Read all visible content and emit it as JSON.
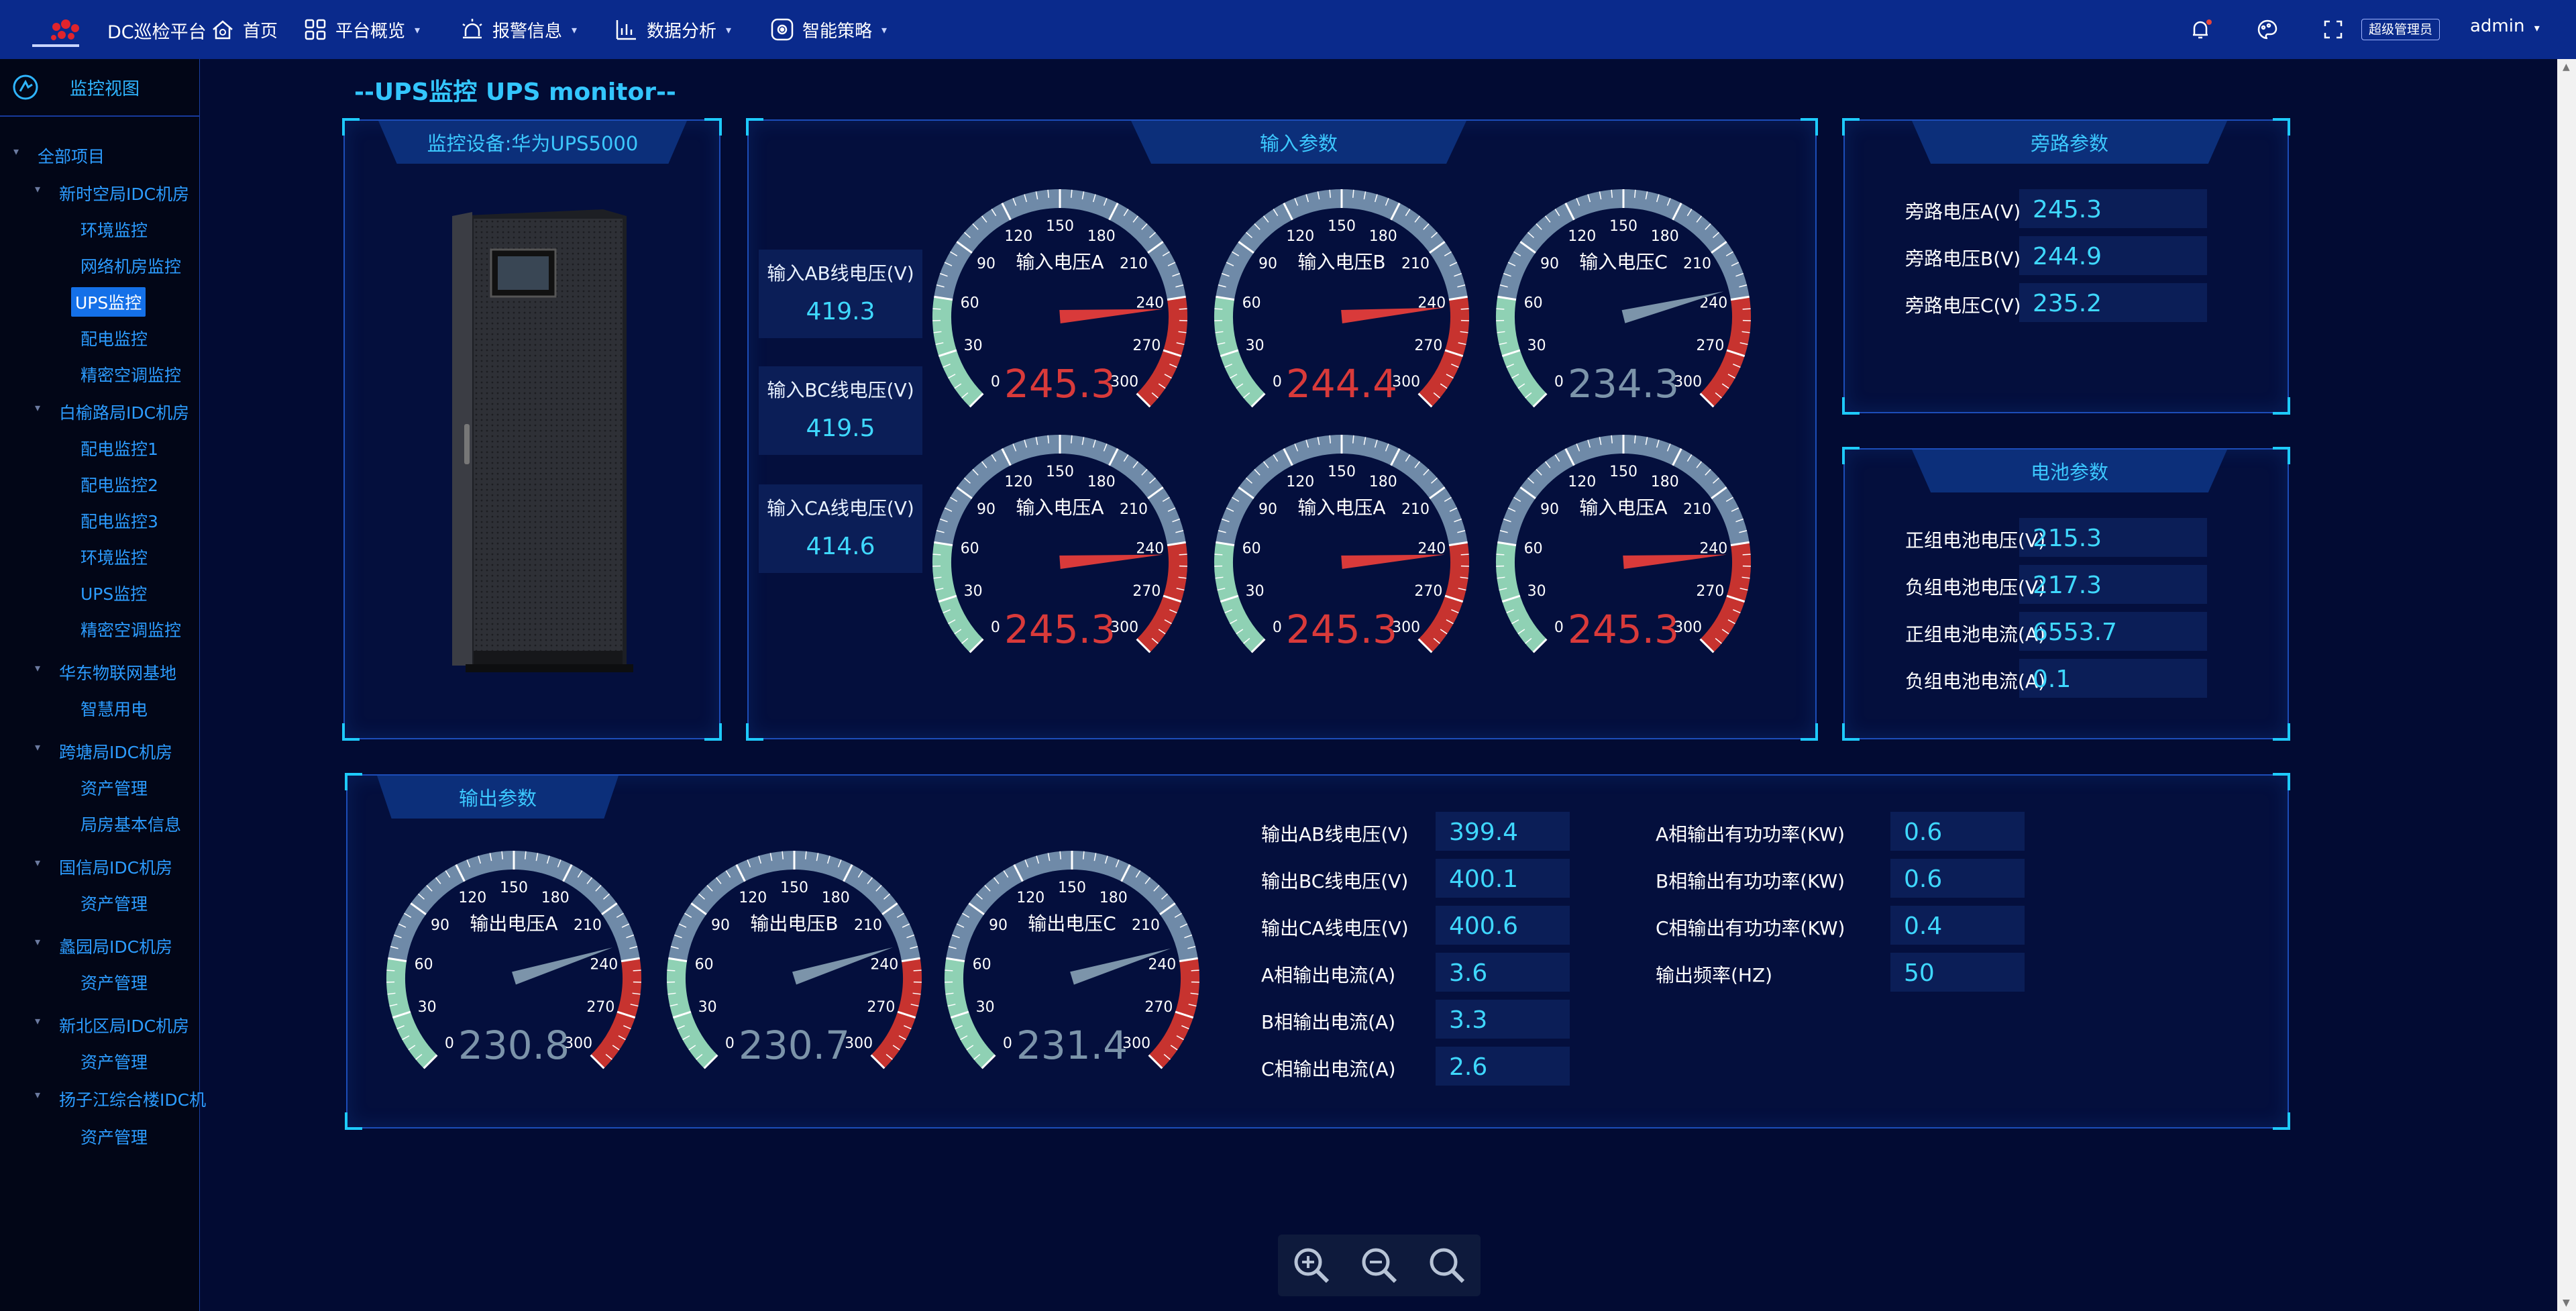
{
  "header": {
    "app_title": "DC巡检平台",
    "nav": [
      {
        "label": "首页",
        "icon": "home-icon",
        "caret": false
      },
      {
        "label": "平台概览",
        "icon": "grid-icon",
        "caret": true
      },
      {
        "label": "报警信息",
        "icon": "alarm-icon",
        "caret": true
      },
      {
        "label": "数据分析",
        "icon": "bar-chart-icon",
        "caret": true
      },
      {
        "label": "智能策略",
        "icon": "strategy-icon",
        "caret": true
      }
    ],
    "role": "超级管理员",
    "user": "admin",
    "caret": "▾"
  },
  "sidebar": {
    "heading": "监控视图",
    "items": [
      {
        "label": "全部项目",
        "level": 0,
        "arrow": true
      },
      {
        "label": "新时空局IDC机房",
        "level": 1,
        "arrow": true
      },
      {
        "label": "环境监控",
        "level": 2
      },
      {
        "label": "网络机房监控",
        "level": 2
      },
      {
        "label": "UPS监控",
        "level": 2,
        "active": true
      },
      {
        "label": "配电监控",
        "level": 2
      },
      {
        "label": "精密空调监控",
        "level": 2
      },
      {
        "label": "白榆路局IDC机房",
        "level": 1,
        "arrow": true
      },
      {
        "label": "配电监控1",
        "level": 2
      },
      {
        "label": "配电监控2",
        "level": 2
      },
      {
        "label": "配电监控3",
        "level": 2
      },
      {
        "label": "环境监控",
        "level": 2
      },
      {
        "label": "UPS监控",
        "level": 2
      },
      {
        "label": "精密空调监控",
        "level": 2
      },
      {
        "label": "华东物联网基地",
        "level": 1,
        "arrow": true
      },
      {
        "label": "智慧用电",
        "level": 2
      },
      {
        "label": "跨塘局IDC机房",
        "level": 1,
        "arrow": true
      },
      {
        "label": "资产管理",
        "level": 2
      },
      {
        "label": "局房基本信息",
        "level": 2
      },
      {
        "label": "国信局IDC机房",
        "level": 1,
        "arrow": true
      },
      {
        "label": "资产管理",
        "level": 2
      },
      {
        "label": "蠡园局IDC机房",
        "level": 1,
        "arrow": true
      },
      {
        "label": "资产管理",
        "level": 2
      },
      {
        "label": "新北区局IDC机房",
        "level": 1,
        "arrow": true
      },
      {
        "label": "资产管理",
        "level": 2
      },
      {
        "label": "扬子江综合楼IDC机",
        "level": 1,
        "arrow": true
      },
      {
        "label": "资产管理",
        "level": 2
      }
    ]
  },
  "page_title": "--UPS监控 UPS monitor--",
  "device_panel": {
    "title": "监控设备:华为UPS5000"
  },
  "input_panel": {
    "title": "输入参数",
    "line_voltages": [
      {
        "label": "输入AB线电压(V)",
        "value": "419.3"
      },
      {
        "label": "输入BC线电压(V)",
        "value": "419.5"
      },
      {
        "label": "输入CA线电压(V)",
        "value": "414.6"
      }
    ]
  },
  "gauge_ticks": [
    "0",
    "30",
    "60",
    "90",
    "120",
    "150",
    "180",
    "210",
    "240",
    "270",
    "300"
  ],
  "gauges_input": [
    {
      "title": "输入电压A",
      "value": "245.3",
      "needle_value": 245.3,
      "color": "#d93a3a"
    },
    {
      "title": "输入电压B",
      "value": "244.4",
      "needle_value": 244.4,
      "color": "#d93a3a"
    },
    {
      "title": "输入电压C",
      "value": "234.3",
      "needle_value": 234.3,
      "color": "#7c94aa"
    },
    {
      "title": "输入电压A",
      "value": "245.3",
      "needle_value": 245.3,
      "color": "#d93a3a"
    },
    {
      "title": "输入电压A",
      "value": "245.3",
      "needle_value": 245.3,
      "color": "#d93a3a"
    },
    {
      "title": "输入电压A",
      "value": "245.3",
      "needle_value": 245.3,
      "color": "#d93a3a"
    }
  ],
  "bypass_panel": {
    "title": "旁路参数",
    "rows": [
      {
        "label": "旁路电压A(V)",
        "value": "245.3"
      },
      {
        "label": "旁路电压B(V)",
        "value": "244.9"
      },
      {
        "label": "旁路电压C(V)",
        "value": "235.2"
      }
    ]
  },
  "battery_panel": {
    "title": "电池参数",
    "rows": [
      {
        "label": "正组电池电压(V)",
        "value": "215.3"
      },
      {
        "label": "负组电池电压(V)",
        "value": "217.3"
      },
      {
        "label": "正组电池电流(A)",
        "value": "6553.7"
      },
      {
        "label": "负组电池电流(A)",
        "value": "0.1"
      }
    ]
  },
  "output_panel": {
    "title": "输出参数",
    "gauges": [
      {
        "title": "输出电压A",
        "value": "230.8",
        "needle_value": 230.8,
        "color": "#7c94aa"
      },
      {
        "title": "输出电压B",
        "value": "230.7",
        "needle_value": 230.7,
        "color": "#7c94aa"
      },
      {
        "title": "输出电压C",
        "value": "231.4",
        "needle_value": 231.4,
        "color": "#7c94aa"
      }
    ],
    "rows_left": [
      {
        "label": "输出AB线电压(V)",
        "value": "399.4"
      },
      {
        "label": "输出BC线电压(V)",
        "value": "400.1"
      },
      {
        "label": "输出CA线电压(V)",
        "value": "400.6"
      },
      {
        "label": "A相输出电流(A)",
        "value": "3.6"
      },
      {
        "label": "B相输出电流(A)",
        "value": "3.3"
      },
      {
        "label": "C相输出电流(A)",
        "value": "2.6"
      }
    ],
    "rows_right": [
      {
        "label": "A相输出有功功率(KW)",
        "value": "0.6"
      },
      {
        "label": "B相输出有功功率(KW)",
        "value": "0.6"
      },
      {
        "label": "C相输出有功功率(KW)",
        "value": "0.4"
      },
      {
        "label": "输出频率(HZ)",
        "value": "50"
      }
    ]
  },
  "zoom_controls": [
    "zoom-in-icon",
    "zoom-out-icon",
    "search-icon"
  ]
}
